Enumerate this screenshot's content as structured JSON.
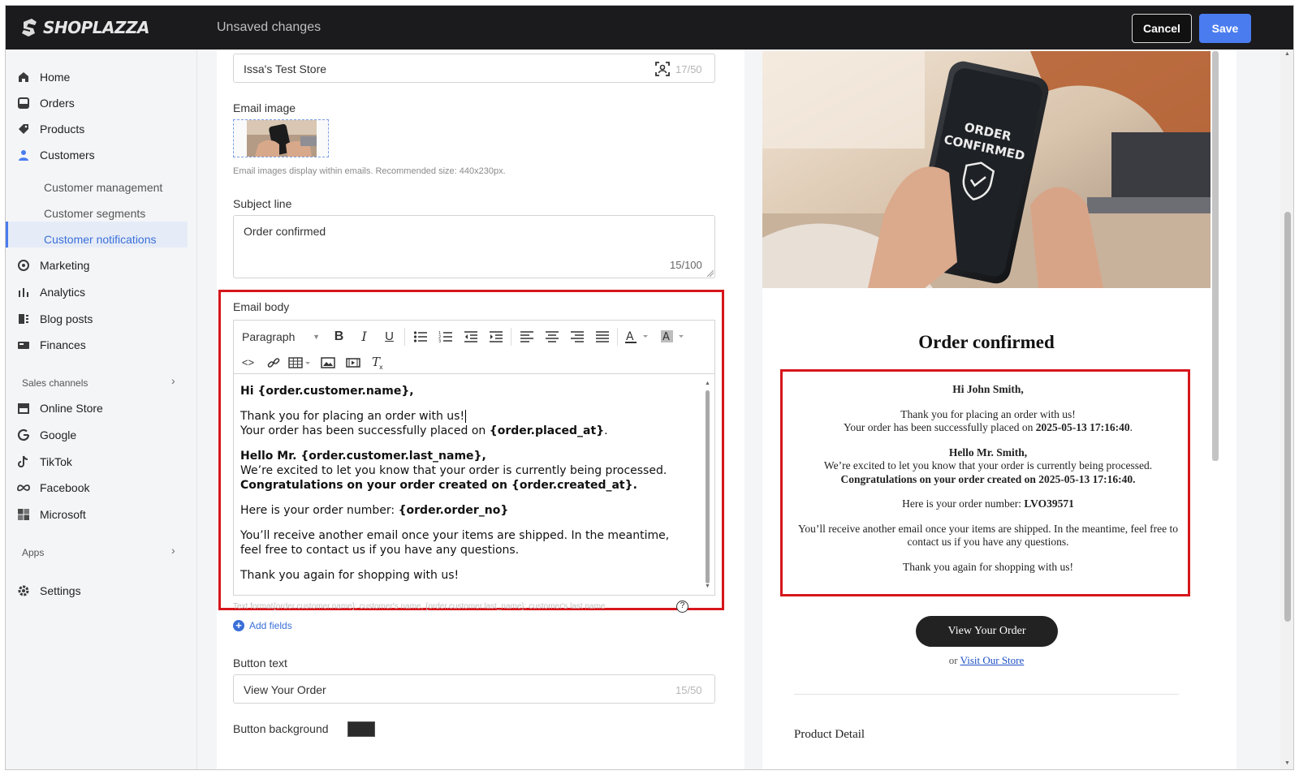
{
  "topbar": {
    "brand": "SHOPLAZZA",
    "status": "Unsaved changes",
    "cancel_label": "Cancel",
    "save_label": "Save"
  },
  "sidebar": {
    "items": [
      {
        "label": "Home",
        "icon": "home-icon"
      },
      {
        "label": "Orders",
        "icon": "orders-icon"
      },
      {
        "label": "Products",
        "icon": "tag-icon"
      },
      {
        "label": "Customers",
        "icon": "person-icon"
      }
    ],
    "customer_sub": [
      "Customer management",
      "Customer segments",
      "Customer notifications"
    ],
    "items2": [
      {
        "label": "Marketing",
        "icon": "marketing-icon"
      },
      {
        "label": "Analytics",
        "icon": "analytics-icon"
      },
      {
        "label": "Blog posts",
        "icon": "blog-icon"
      },
      {
        "label": "Finances",
        "icon": "finances-icon"
      }
    ],
    "sales_channels_label": "Sales channels",
    "channels": [
      "Online Store",
      "Google",
      "TikTok",
      "Facebook",
      "Microsoft"
    ],
    "apps_label": "Apps",
    "settings_label": "Settings"
  },
  "editor": {
    "store_name_value": "Issa's Test Store",
    "store_name_counter": "17/50",
    "email_image_label": "Email image",
    "email_image_hint": "Email images display within emails. Recommended size: 440x230px.",
    "subject_label": "Subject line",
    "subject_value": "Order confirmed",
    "subject_counter": "15/100",
    "body_label": "Email body",
    "paragraph_select": "Paragraph",
    "body": {
      "l1": "Hi {order.customer.name},",
      "l2": "Thank you for placing an order with us!",
      "l3a": "Your order has been successfully placed on ",
      "l3b": "{order.placed_at}",
      "l3c": ".",
      "l4": "Hello Mr. {order.customer.last_name},",
      "l5": "We’re excited to let you know that your order is currently being processed.",
      "l6": "Congratulations on your order created on {order.created_at}.",
      "l7a": "Here is your order number: ",
      "l7b": "{order.order_no}",
      "l8": "You’ll receive another email once your items are shipped. In the meantime, feel free to contact us if you have any questions.",
      "l9": "Thank you again for shopping with us!"
    },
    "body_hint": "Text format{order.customer.name}: customer's name, {order.customer.last_name}: customer's last name",
    "add_fields_label": "Add fields",
    "button_text_label": "Button text",
    "button_text_value": "View Your Order",
    "button_text_counter": "15/50",
    "button_bg_label": "Button background",
    "button_bg_color": "#2b2b2b"
  },
  "preview": {
    "hero_text_1": "ORDER",
    "hero_text_2": "CONFIRMED",
    "title": "Order confirmed",
    "greeting": "Hi John Smith,",
    "p1": "Thank you for placing an order with us!",
    "p2a": "Your order has been successfully placed on ",
    "p2b": "2025-05-13 17:16:40",
    "p2c": ".",
    "hello": "Hello Mr. Smith,",
    "p3": "We’re excited to let you know that your order is currently being processed.",
    "p4": "Congratulations on your order created on 2025-05-13 17:16:40.",
    "p5a": "Here is your order number: ",
    "p5b": "LVO39571",
    "p6": "You’ll receive another email once your items are shipped. In the meantime, feel free to contact us if you have any questions.",
    "p7": "Thank you again for shopping with us!",
    "button": "View Your Order",
    "or": "or ",
    "visit_store": "Visit Our Store",
    "product_detail": "Product Detail"
  },
  "colors": {
    "accent": "#4a7cf0",
    "highlight": "#d6161c",
    "topbar": "#1b1b1d"
  }
}
